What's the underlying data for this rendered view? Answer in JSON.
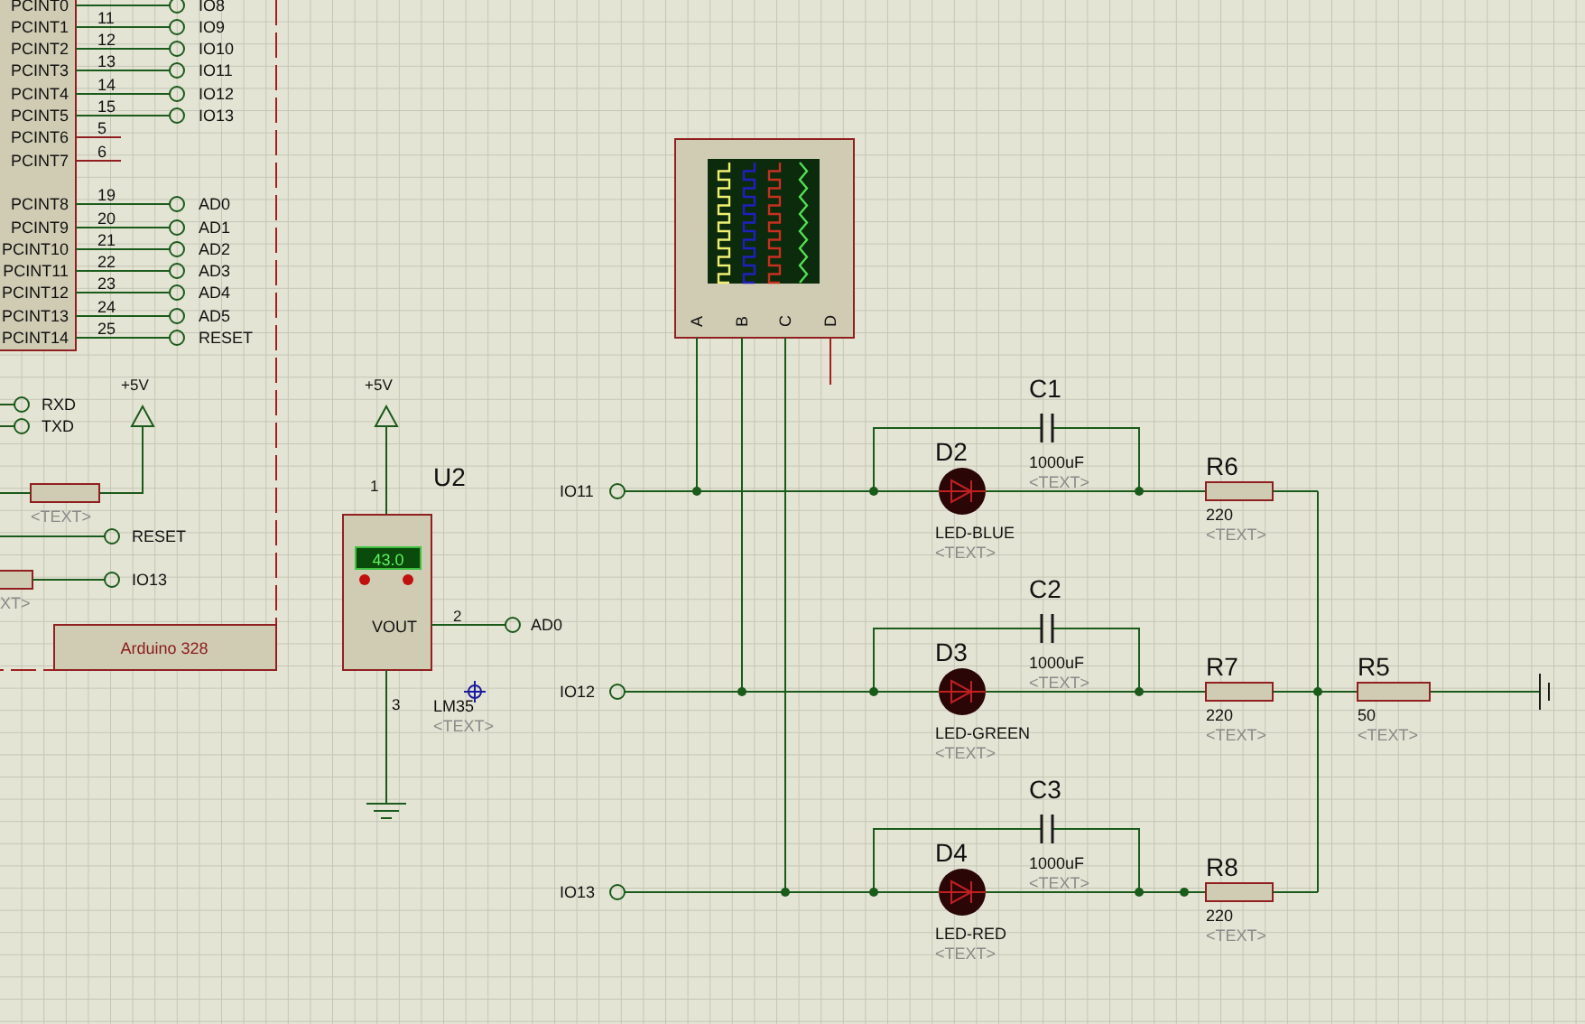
{
  "arduino": {
    "pins": [
      {
        "name": "PCINT0",
        "net": "IO8"
      },
      {
        "name": "PCINT1",
        "number": "11",
        "net": "IO9"
      },
      {
        "name": "PCINT2",
        "number": "12",
        "net": "IO10"
      },
      {
        "name": "PCINT3",
        "number": "13",
        "net": "IO11"
      },
      {
        "name": "PCINT4",
        "number": "14",
        "net": "IO12"
      },
      {
        "name": "PCINT5",
        "number": "15",
        "net": "IO13"
      },
      {
        "name": "PCINT6",
        "number": "5"
      },
      {
        "name": "PCINT7",
        "number": "6"
      },
      {
        "name": "PCINT8",
        "number": "19",
        "net": "AD0"
      },
      {
        "name": "PCINT9",
        "number": "20",
        "net": "AD1"
      },
      {
        "name": "PCINT10",
        "number": "21",
        "net": "AD2"
      },
      {
        "name": "PCINT11",
        "number": "22",
        "net": "AD3"
      },
      {
        "name": "PCINT12",
        "number": "23",
        "net": "AD4"
      },
      {
        "name": "PCINT13",
        "number": "24",
        "net": "AD5"
      },
      {
        "name": "PCINT14",
        "number": "25",
        "net": "RESET"
      }
    ],
    "serial": [
      "RXD",
      "TXD"
    ],
    "supply": "+5V",
    "pullup_text": "<TEXT>",
    "reset_net": "RESET",
    "io13_net": "IO13",
    "io13_text": "XT>",
    "label": "Arduino 328"
  },
  "sensor": {
    "ref": "U2",
    "supply": "+5V",
    "reading": "43.0",
    "pin_name": "VOUT",
    "pin_numbers": [
      "1",
      "2",
      "3"
    ],
    "net": "AD0",
    "part": "LM35",
    "text": "<TEXT>"
  },
  "oscilloscope": {
    "channels": [
      {
        "label": "A",
        "kind": "square",
        "color": "#f0f070"
      },
      {
        "label": "B",
        "kind": "square",
        "color": "#2020c0"
      },
      {
        "label": "C",
        "kind": "square",
        "color": "#c83020"
      },
      {
        "label": "D",
        "kind": "triangle",
        "color": "#50e050"
      }
    ]
  },
  "branches": [
    {
      "net": "IO11",
      "led_ref": "D2",
      "led_part": "LED-BLUE",
      "led_text": "<TEXT>",
      "cap_ref": "C1",
      "cap_value": "1000uF",
      "cap_text": "<TEXT>",
      "res_ref": "R6",
      "res_value": "220",
      "res_text": "<TEXT>"
    },
    {
      "net": "IO12",
      "led_ref": "D3",
      "led_part": "LED-GREEN",
      "led_text": "<TEXT>",
      "cap_ref": "C2",
      "cap_value": "1000uF",
      "cap_text": "<TEXT>",
      "res_ref": "R7",
      "res_value": "220",
      "res_text": "<TEXT>"
    },
    {
      "net": "IO13",
      "led_ref": "D4",
      "led_part": "LED-RED",
      "led_text": "<TEXT>",
      "cap_ref": "C3",
      "cap_value": "1000uF",
      "cap_text": "<TEXT>",
      "res_ref": "R8",
      "res_value": "220",
      "res_text": "<TEXT>"
    }
  ],
  "load": {
    "ref": "R5",
    "value": "50",
    "text": "<TEXT>"
  }
}
